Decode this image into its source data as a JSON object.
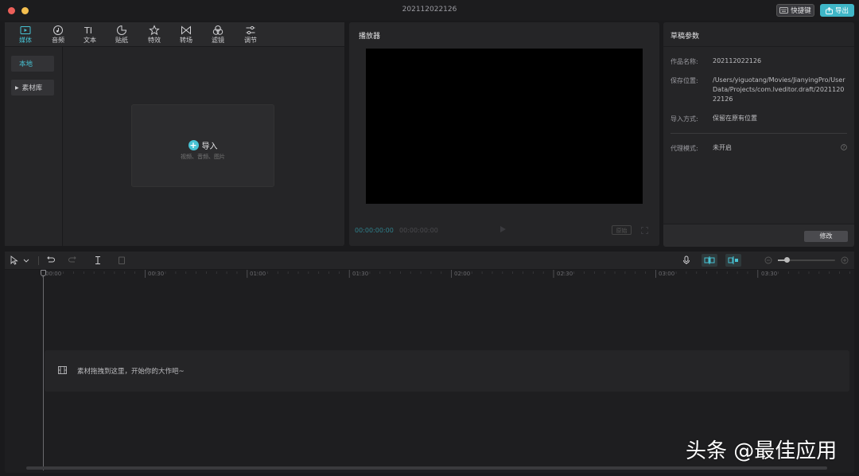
{
  "window": {
    "title": "202112022126"
  },
  "topbar": {
    "shortcut_label": "快捷键",
    "export_label": "导出"
  },
  "colors": {
    "accent": "#47c2d3",
    "close": "#ec5f59",
    "minimize": "#f4bf4f"
  },
  "media": {
    "tabs": [
      {
        "label": "媒体",
        "icon": "media-icon"
      },
      {
        "label": "音频",
        "icon": "audio-icon"
      },
      {
        "label": "文本",
        "icon": "text-icon"
      },
      {
        "label": "贴纸",
        "icon": "sticker-icon"
      },
      {
        "label": "特效",
        "icon": "effects-icon"
      },
      {
        "label": "转场",
        "icon": "transition-icon"
      },
      {
        "label": "滤镜",
        "icon": "filter-icon"
      },
      {
        "label": "调节",
        "icon": "adjust-icon"
      }
    ],
    "sidebar": {
      "local": "本地",
      "library": "素材库"
    },
    "import": {
      "title": "导入",
      "subtitle": "视频、音频、图片"
    }
  },
  "player": {
    "title": "播放器",
    "current_time": "00:00:00:00",
    "total_time": "00:00:00:00",
    "original_label": "原始"
  },
  "draft": {
    "title": "草稿参数",
    "name_label": "作品名称:",
    "name_value": "202112022126",
    "save_label": "保存位置:",
    "save_line1": "/Users/yiguotang/Movies/JianyingPro/User",
    "save_line2": "Data/Projects/com.lveditor.draft/2021120",
    "save_line3": "22126",
    "import_label": "导入方式:",
    "import_value": "保留在原有位置",
    "proxy_label": "代理模式:",
    "proxy_value": "未开启",
    "modify_label": "修改"
  },
  "timeline": {
    "ticks": [
      "00:00",
      "00:30",
      "01:00",
      "01:30",
      "02:00",
      "02:30",
      "03:00",
      "03:30"
    ],
    "drop_text": "素材拖拽到这里，开始你的大作吧~"
  },
  "watermark": "头条 @最佳应用"
}
